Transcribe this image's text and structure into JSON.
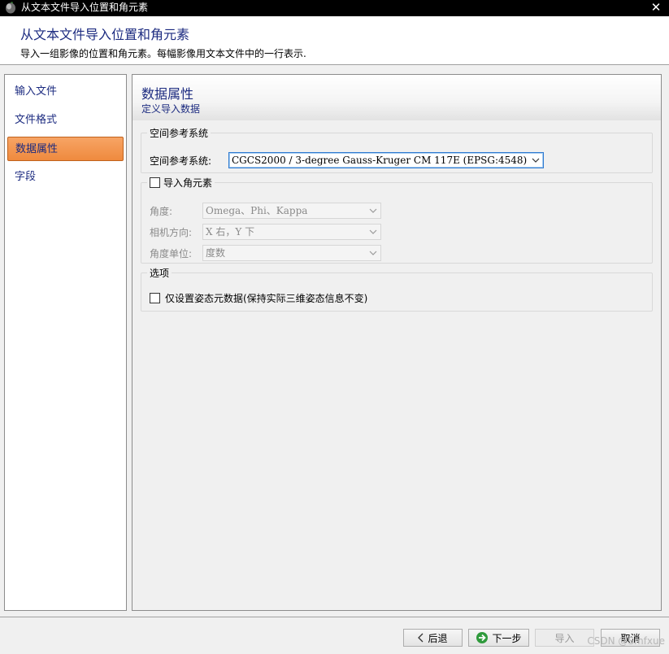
{
  "window": {
    "title": "从文本文件导入位置和角元素"
  },
  "header": {
    "title": "从文本文件导入位置和角元素",
    "subtitle": "导入一组影像的位置和角元素。每幅影像用文本文件中的一行表示."
  },
  "sidebar": {
    "items": [
      {
        "label": "输入文件",
        "active": false
      },
      {
        "label": "文件格式",
        "active": false
      },
      {
        "label": "数据属性",
        "active": true
      },
      {
        "label": "字段",
        "active": false
      }
    ]
  },
  "panel": {
    "title": "数据属性",
    "subtitle": "定义导入数据"
  },
  "srs_group": {
    "legend": "空间参考系统",
    "label": "空间参考系统:",
    "value": "CGCS2000 / 3-degree Gauss-Kruger CM 117E (EPSG:4548)"
  },
  "angle_group": {
    "legend": "导入角元素",
    "checked": false,
    "fields": [
      {
        "label": "角度:",
        "value": "Omega、Phi、Kappa"
      },
      {
        "label": "相机方向:",
        "value": "X 右，Y 下"
      },
      {
        "label": "角度单位:",
        "value": "度数"
      }
    ]
  },
  "options_group": {
    "legend": "选项",
    "checkbox_label": "仅设置姿态元数据(保持实际三维姿态信息不变)",
    "checked": false
  },
  "footer": {
    "back_label": "后退",
    "next_label": "下一步",
    "import_label": "导入",
    "cancel_label": "取消"
  },
  "watermark": "CSDN @Smfxue",
  "colors": {
    "accent_text": "#1c2b80",
    "active_item": "#ef8a3e",
    "focus_border": "#2e7ad1"
  }
}
